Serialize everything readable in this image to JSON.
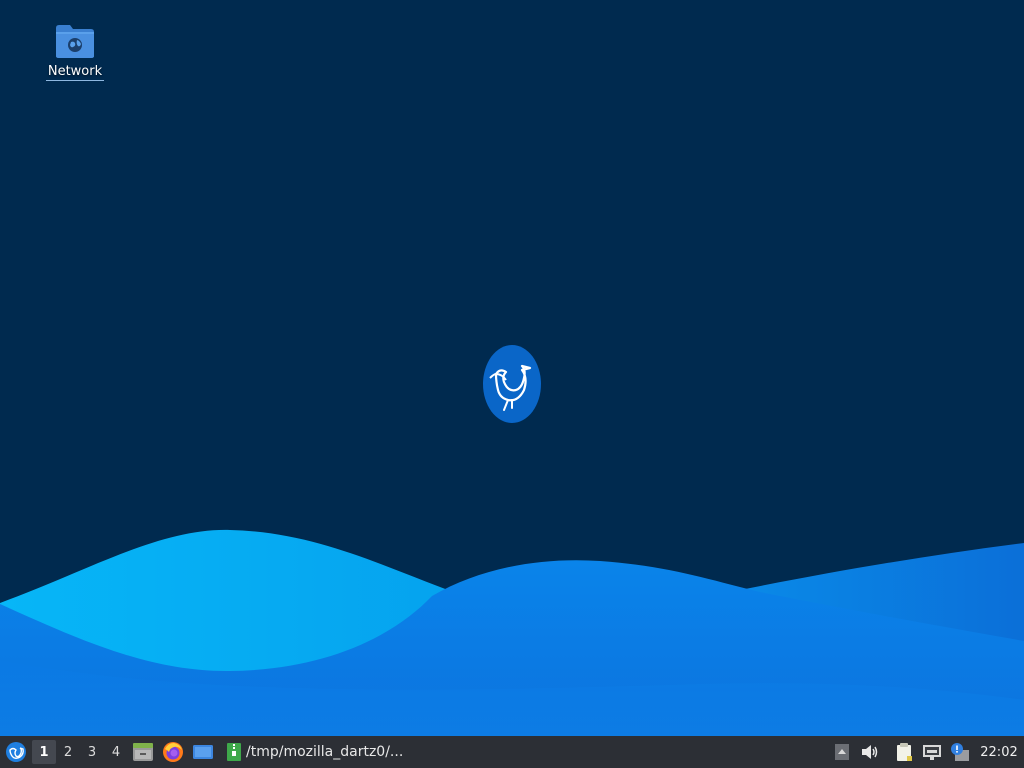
{
  "desktop": {
    "icons": [
      {
        "label": "Network",
        "icon": "network-folder-icon"
      }
    ],
    "center_logo": "lubuntu-bird-logo",
    "colors": {
      "background": "#002a4f",
      "wave_light": "#06a0ee",
      "wave_mid": "#0a7be6"
    }
  },
  "taskbar": {
    "start_icon": "lubuntu-menu-icon",
    "workspaces": [
      "1",
      "2",
      "3",
      "4"
    ],
    "active_workspace": "1",
    "launchers": [
      {
        "name": "file-manager-icon"
      },
      {
        "name": "firefox-icon"
      },
      {
        "name": "show-desktop-icon"
      }
    ],
    "task": {
      "label": "/tmp/mozilla_dartz0/...",
      "icon": "archive-icon"
    },
    "tray": [
      {
        "name": "tray-arrow-icon"
      },
      {
        "name": "volume-icon"
      },
      {
        "name": "clipboard-icon"
      },
      {
        "name": "network-icon"
      },
      {
        "name": "update-notifier-icon"
      }
    ],
    "clock": "22:02"
  }
}
